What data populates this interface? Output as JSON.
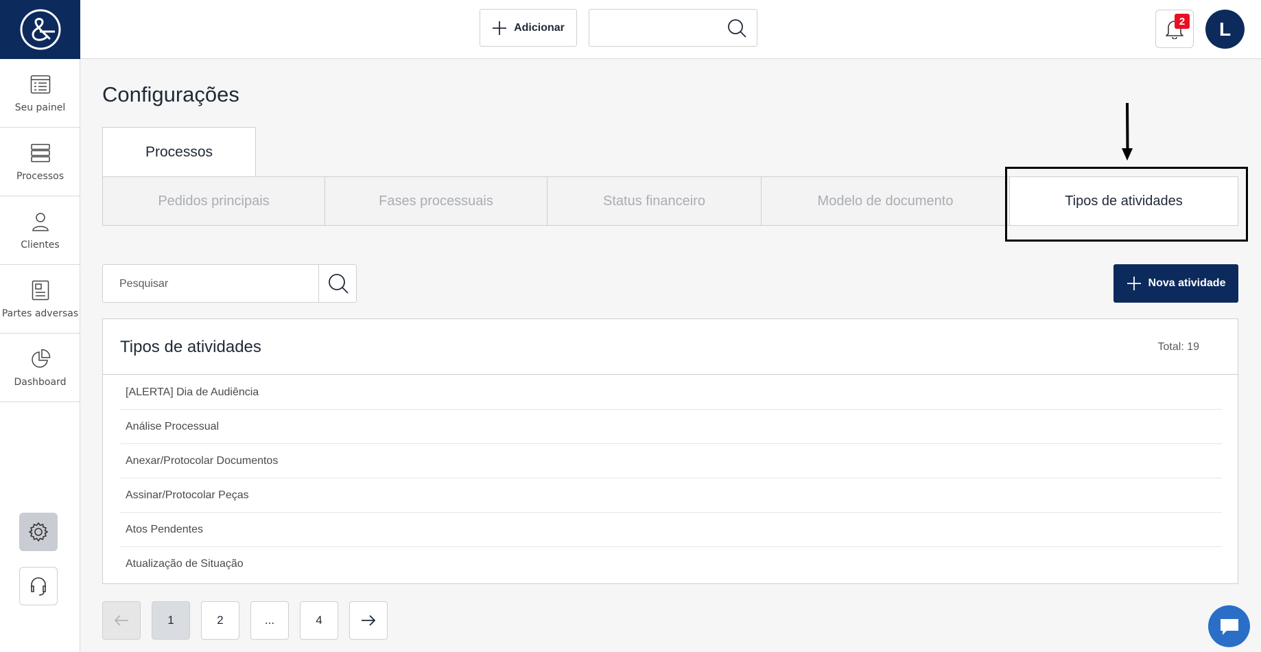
{
  "sidebar": {
    "items": [
      {
        "label": "Seu painel",
        "icon": "dashboard-list-icon"
      },
      {
        "label": "Processos",
        "icon": "stack-icon"
      },
      {
        "label": "Clientes",
        "icon": "user-icon"
      },
      {
        "label": "Partes adversas",
        "icon": "document-icon"
      },
      {
        "label": "Dashboard",
        "icon": "pie-chart-icon"
      }
    ]
  },
  "header": {
    "add_label": "Adicionar",
    "search_value": "",
    "notifications_count": "2",
    "avatar_initial": "L"
  },
  "page": {
    "title": "Configurações",
    "main_tab": "Processos",
    "subtabs": [
      "Pedidos principais",
      "Fases processuais",
      "Status financeiro",
      "Modelo de documento",
      "Tipos de atividades"
    ],
    "active_subtab": "Tipos de atividades"
  },
  "search": {
    "placeholder": "Pesquisar"
  },
  "new_button_label": "Nova atividade",
  "card": {
    "title": "Tipos de atividades",
    "total_label": "Total: 19",
    "items": [
      "[ALERTA] Dia de Audiência",
      "Análise Processual",
      "Anexar/Protocolar Documentos",
      "Assinar/Protocolar Peças",
      "Atos Pendentes",
      "Atualização de Situação"
    ]
  },
  "pagination": {
    "pages": [
      "1",
      "2",
      "...",
      "4"
    ],
    "current": "1"
  },
  "colors": {
    "brand": "#0d2a5c",
    "badge": "#e81123",
    "chat": "#2b6ec7"
  }
}
